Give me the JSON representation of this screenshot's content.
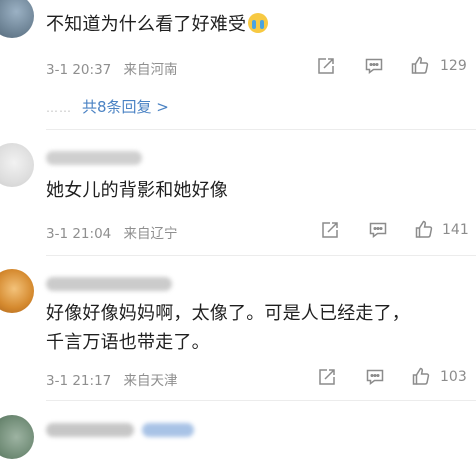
{
  "comments": [
    {
      "text": "不知道为什么看了好难受",
      "emoji": "crying-face-emoji",
      "date": "3-1 20:37",
      "location": "来自河南",
      "likes": "129",
      "replies": "共8条回复 >",
      "reply_dots": "……"
    },
    {
      "text": "她女儿的背影和她好像",
      "date": "3-1 21:04",
      "location": "来自辽宁",
      "likes": "141"
    },
    {
      "text_line1": "好像好像妈妈啊，太像了。可是人已经走了，",
      "text_line2": "千言万语也带走了。",
      "date": "3-1 21:17",
      "location": "来自天津",
      "likes": "103"
    }
  ],
  "icons": {
    "share": "share-icon",
    "reply": "comment-icon",
    "like": "thumbs-up-icon"
  },
  "colors": {
    "link": "#4b83c4",
    "meta": "#8f8f8f",
    "icon": "#8c8c8c",
    "divider": "#ececec"
  }
}
